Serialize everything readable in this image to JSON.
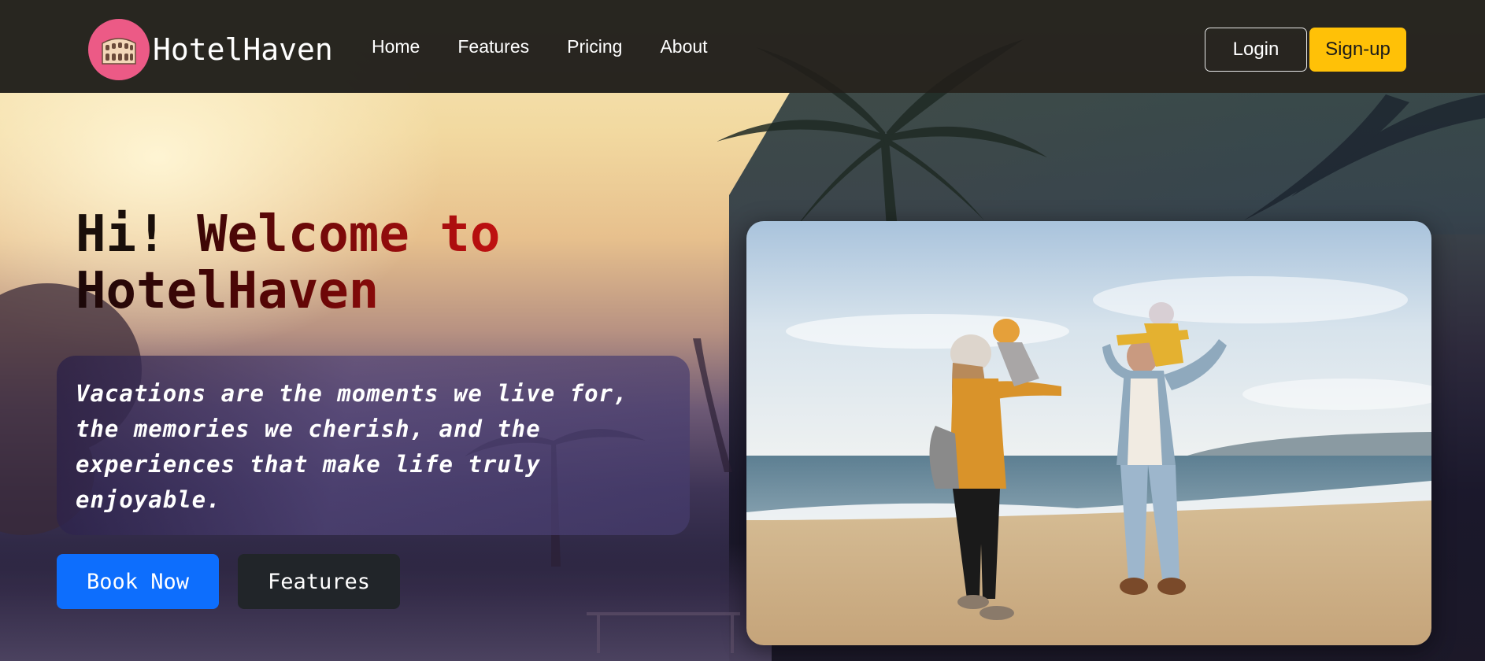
{
  "navbar": {
    "logo_icon": "colosseum-icon",
    "brand_name": "HotelHaven",
    "links": [
      {
        "label": "Home"
      },
      {
        "label": "Features"
      },
      {
        "label": "Pricing"
      },
      {
        "label": "About"
      }
    ],
    "login_label": "Login",
    "signup_label": "Sign-up"
  },
  "hero": {
    "title_part1": "Hi! ",
    "title_part2": "Welcome to",
    "title_part3": "HotelHaven",
    "quote": "Vacations are the moments we live for, the memories we cherish, and the experiences that make life truly enjoyable.",
    "book_now_label": "Book Now",
    "features_label": "Features",
    "photo_icon": "family-beach-photo"
  },
  "colors": {
    "navbar_bg": "#211f1b",
    "logo_bg": "#ec5a86",
    "signup_bg": "#ffc107",
    "book_now_bg": "#0d6efd",
    "features_bg": "#212529",
    "title_dark": "#1a0f0a",
    "title_red": "#c01010"
  }
}
